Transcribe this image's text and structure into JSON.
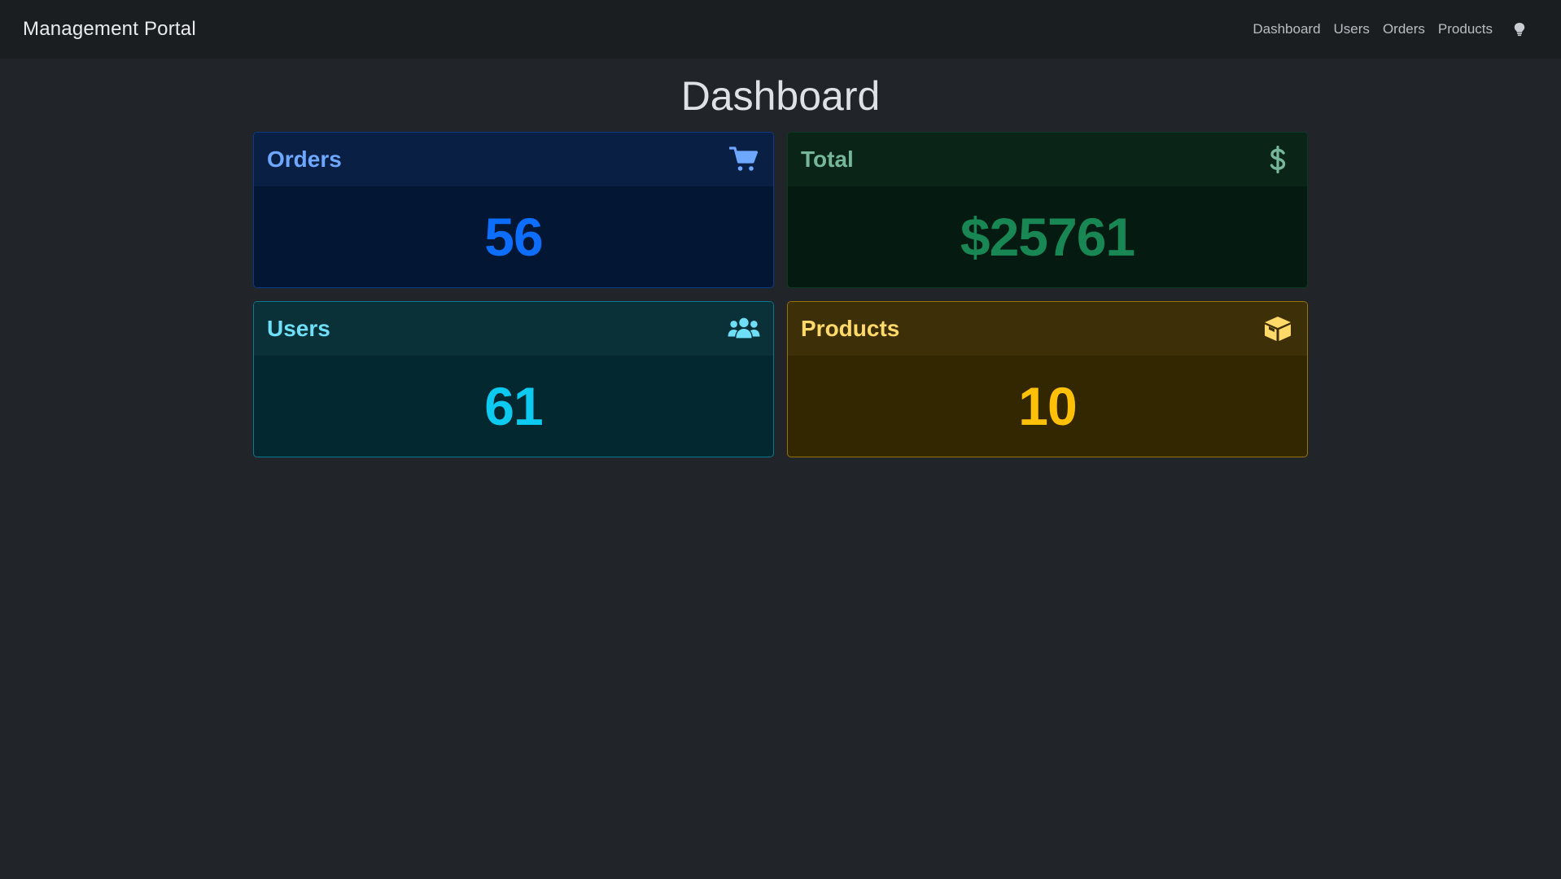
{
  "navbar": {
    "brand": "Management Portal",
    "links": [
      {
        "label": "Dashboard"
      },
      {
        "label": "Users"
      },
      {
        "label": "Orders"
      },
      {
        "label": "Products"
      }
    ],
    "theme_toggle_icon": "lightbulb-icon"
  },
  "page": {
    "title": "Dashboard"
  },
  "cards": [
    {
      "title": "Orders",
      "value": "56",
      "icon": "cart-icon",
      "accent": "#0d6efd"
    },
    {
      "title": "Total",
      "value": "$25761",
      "icon": "dollar-icon",
      "accent": "#198754"
    },
    {
      "title": "Users",
      "value": "61",
      "icon": "users-icon",
      "accent": "#0dcaf0"
    },
    {
      "title": "Products",
      "value": "10",
      "icon": "box-icon",
      "accent": "#ffc107"
    }
  ]
}
